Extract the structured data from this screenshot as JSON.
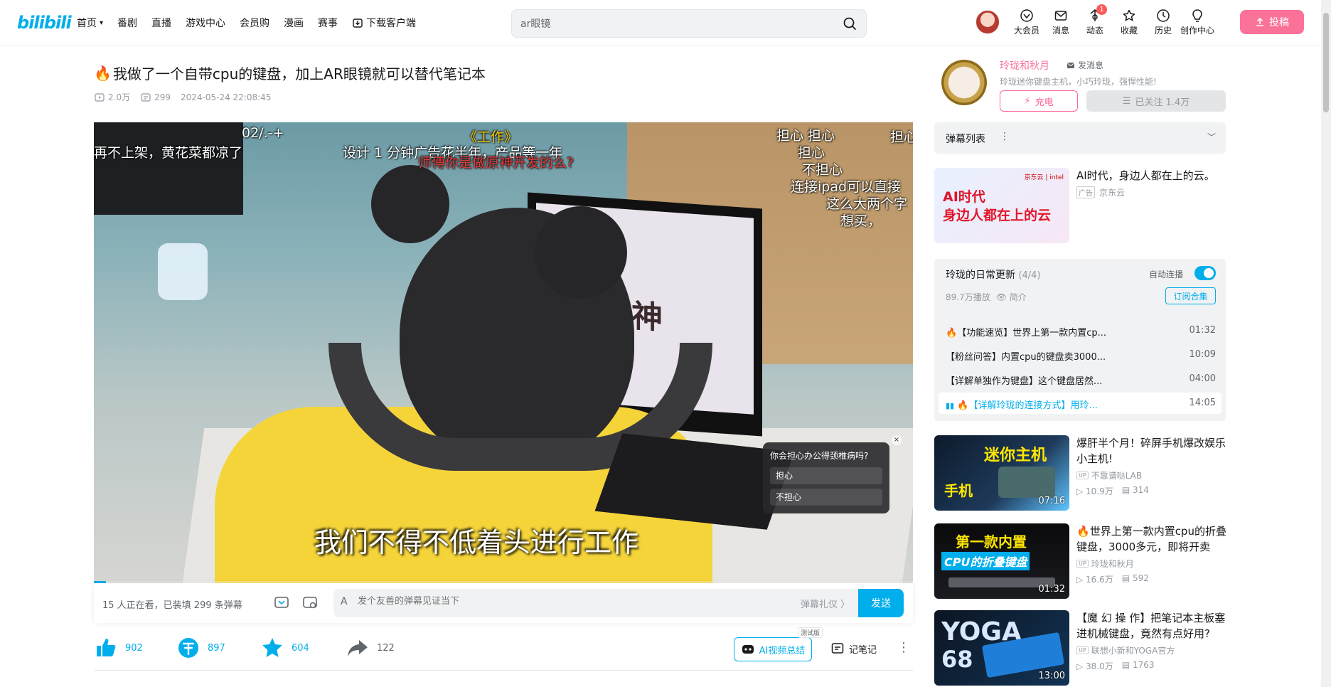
{
  "header": {
    "logo": "bilibili",
    "nav": [
      {
        "label": "首页",
        "has_chevron": true
      },
      {
        "label": "番剧"
      },
      {
        "label": "直播"
      },
      {
        "label": "游戏中心"
      },
      {
        "label": "会员购"
      },
      {
        "label": "漫画"
      },
      {
        "label": "赛事"
      },
      {
        "label": "下载客户端",
        "icon": "download-icon"
      }
    ],
    "search_value": "ar眼镜",
    "icons": [
      {
        "label": "大会员",
        "icon": "vip-icon"
      },
      {
        "label": "消息",
        "icon": "message-icon"
      },
      {
        "label": "动态",
        "icon": "dynamic-icon",
        "badge": "1"
      },
      {
        "label": "收藏",
        "icon": "favorite-icon"
      },
      {
        "label": "历史",
        "icon": "history-icon"
      },
      {
        "label": "创作中心",
        "icon": "creator-icon"
      }
    ],
    "upload_label": "投稿"
  },
  "video": {
    "title": "我做了一个自带cpu的键盘，加上AR眼镜就可以替代笔记本",
    "views": "2.0万",
    "danmaku_count": "299",
    "date": "2024-05-24 22:08:45",
    "subtitle": "我们不得不低着头进行工作",
    "danmaku": [
      {
        "text": "02/.-+",
        "style": "white"
      },
      {
        "text": "再不上架，黄花菜都凉了",
        "style": "white"
      },
      {
        "text": "《工作》",
        "style": "gold"
      },
      {
        "text": "设计 1 分钟广告花半年，产品等一年",
        "style": "white"
      },
      {
        "text": "师傅你是做原神开发的么?",
        "style": "red"
      },
      {
        "text": "担心 担心",
        "style": "white"
      },
      {
        "text": "担心",
        "style": "white"
      },
      {
        "text": "担心",
        "style": "white"
      },
      {
        "text": "不担心",
        "style": "white"
      },
      {
        "text": "连接ipad可以直接",
        "style": "white"
      },
      {
        "text": "这么大两个字",
        "style": "white"
      },
      {
        "text": "想买，",
        "style": "white"
      }
    ],
    "scene_logo": "原神",
    "poll": {
      "question": "你会担心办公得颈椎病吗?",
      "options": [
        "担心",
        "不担心"
      ]
    },
    "progress": 0.015
  },
  "sendbar": {
    "viewers": "15 人正在看，已装填 299 条弹幕",
    "placeholder": "发个友善的弹幕见证当下",
    "etiquette": "弹幕礼仪 〉",
    "send": "发送"
  },
  "actions": {
    "like": "902",
    "coin": "897",
    "favorite": "604",
    "share": "122",
    "ai_summary": "AI视频总结",
    "ai_tag": "测试版",
    "note": "记笔记"
  },
  "uploader": {
    "name": "玲珑和秋月",
    "message": "发消息",
    "desc": "玲珑迷你键盘主机，小巧玲珑，强悍性能!",
    "charge": "充电",
    "follow": "已关注 1.4万"
  },
  "danmaku_list": {
    "label": "弹幕列表"
  },
  "ad": {
    "line1": "AI时代",
    "line2": "身边人都在上的云",
    "brand": "京东云 | intel",
    "title": "AI时代，身边人都在上的云。",
    "tag": "广告",
    "source": "京东云"
  },
  "playlist": {
    "title": "玲珑的日常更新",
    "count": "(4/4)",
    "autoplay": "自动连播",
    "plays": "89.7万播放",
    "intro": "简介",
    "subscribe": "订阅合集",
    "items": [
      {
        "name": "【功能速览】世界上第一款内置cp...",
        "duration": "01:32",
        "fire": true
      },
      {
        "name": "【粉丝问答】内置cpu的键盘卖3000...",
        "duration": "10:09"
      },
      {
        "name": "【详解单独作为键盘】这个键盘居然...",
        "duration": "04:00"
      },
      {
        "name": "【详解玲珑的连接方式】用玲...",
        "duration": "14:05",
        "fire": true,
        "active": true
      }
    ]
  },
  "recommend": [
    {
      "title": "爆肝半个月！碎屏手机爆改娱乐小主机!",
      "owner": "不靠谱哒LAB",
      "views": "10.9万",
      "danmaku": "314",
      "duration": "07:16",
      "thumb_text1": "迷你主机",
      "thumb_text2": "手机"
    },
    {
      "title": "世界上第一款内置cpu的折叠键盘，3000多元，即将开卖",
      "owner": "玲珑和秋月",
      "views": "16.6万",
      "danmaku": "592",
      "duration": "01:32",
      "fire": true,
      "thumb_text1": "第一款内置",
      "thumb_text2": "CPU的折叠键盘"
    },
    {
      "title": "【魔 幻 操 作】把笔记本主板塞进机械键盘，竟然有点好用?",
      "owner": "联想小新和YOGA官方",
      "views": "38.0万",
      "danmaku": "1763",
      "duration": "13:00",
      "thumb_text1": "YOGA",
      "thumb_text2": "68"
    }
  ]
}
